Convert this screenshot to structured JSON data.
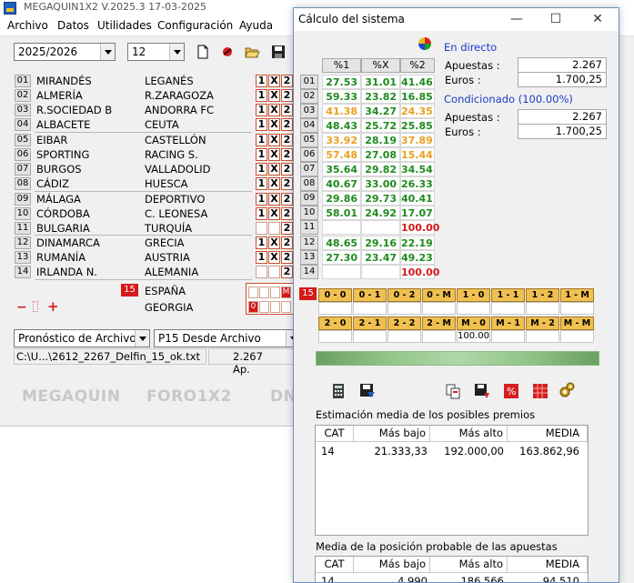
{
  "main": {
    "title": "MEGAQUIN1X2  V.2025.3 17-03-2025",
    "menu": [
      "Archivo",
      "Datos",
      "Utilidades",
      "Configuración",
      "Ayuda"
    ],
    "season": "2025/2026",
    "jornada": "12",
    "matches": [
      {
        "num": "01",
        "home": "MIRANDÉS",
        "away": "LEGANÉS",
        "picks": [
          true,
          true,
          true
        ]
      },
      {
        "num": "02",
        "home": "ALMERÍA",
        "away": "R.ZARAGOZA",
        "picks": [
          true,
          true,
          true
        ]
      },
      {
        "num": "03",
        "home": "R.SOCIEDAD B",
        "away": "ANDORRA FC",
        "picks": [
          true,
          true,
          true
        ]
      },
      {
        "num": "04",
        "home": "ALBACETE",
        "away": "CEUTA",
        "picks": [
          true,
          true,
          true
        ]
      },
      {
        "num": "05",
        "home": "EIBAR",
        "away": "CASTELLÓN",
        "picks": [
          true,
          true,
          true
        ]
      },
      {
        "num": "06",
        "home": "SPORTING",
        "away": "RACING S.",
        "picks": [
          true,
          true,
          true
        ]
      },
      {
        "num": "07",
        "home": "BURGOS",
        "away": "VALLADOLID",
        "picks": [
          true,
          true,
          true
        ]
      },
      {
        "num": "08",
        "home": "CÁDIZ",
        "away": "HUESCA",
        "picks": [
          true,
          true,
          true
        ]
      },
      {
        "num": "09",
        "home": "MÁLAGA",
        "away": "DEPORTIVO",
        "picks": [
          true,
          true,
          true
        ]
      },
      {
        "num": "10",
        "home": "CÓRDOBA",
        "away": "C. LEONESA",
        "picks": [
          true,
          true,
          true
        ]
      },
      {
        "num": "11",
        "home": "BULGARIA",
        "away": "TURQUÍA",
        "picks": [
          false,
          false,
          true
        ]
      },
      {
        "num": "12",
        "home": "DINAMARCA",
        "away": "GRECIA",
        "picks": [
          true,
          true,
          true
        ]
      },
      {
        "num": "13",
        "home": "RUMANÍA",
        "away": "AUSTRIA",
        "picks": [
          true,
          true,
          true
        ]
      },
      {
        "num": "14",
        "home": "IRLANDA N.",
        "away": "ALEMANIA",
        "picks": [
          false,
          false,
          true
        ]
      }
    ],
    "p15": {
      "num": "15",
      "home": "ESPAÑA",
      "away": "GEORGIA",
      "row1": [
        "0",
        "1",
        "2",
        "M"
      ],
      "row2": [
        "0",
        "1",
        "2",
        "M"
      ]
    },
    "pick_labels": [
      "1",
      "X",
      "2"
    ],
    "source_combo": "Pronóstico de Archivo",
    "p15_combo": "P15 Desde Archivo",
    "file_path": "C:\\U...\\2612_2267_Delfin_15_ok.txt",
    "file_bets": "2.267 Ap.",
    "bottom_labels": [
      "MEGAQUIN",
      "FORO1X2",
      "DN"
    ]
  },
  "dialog": {
    "title": "Cálculo del sistema",
    "grid_headers": [
      "%1",
      "%X",
      "%2"
    ],
    "grid": [
      {
        "num": "01",
        "v1": "27.53",
        "vx": "31.01",
        "v2": "41.46",
        "c1": "#1e8a1e",
        "cx": "#1e8a1e",
        "c2": "#1e8a1e"
      },
      {
        "num": "02",
        "v1": "59.33",
        "vx": "23.82",
        "v2": "16.85",
        "c1": "#1e8a1e",
        "cx": "#1e8a1e",
        "c2": "#1e8a1e"
      },
      {
        "num": "03",
        "v1": "41.38",
        "vx": "34.27",
        "v2": "24.35",
        "c1": "#e8a020",
        "cx": "#1e8a1e",
        "c2": "#e8a020"
      },
      {
        "num": "04",
        "v1": "48.43",
        "vx": "25.72",
        "v2": "25.85",
        "c1": "#1e8a1e",
        "cx": "#1e8a1e",
        "c2": "#1e8a1e"
      },
      {
        "num": "05",
        "v1": "33.92",
        "vx": "28.19",
        "v2": "37.89",
        "c1": "#e8a020",
        "cx": "#1e8a1e",
        "c2": "#e8a020"
      },
      {
        "num": "06",
        "v1": "57.48",
        "vx": "27.08",
        "v2": "15.44",
        "c1": "#e8a020",
        "cx": "#1e8a1e",
        "c2": "#e8a020"
      },
      {
        "num": "07",
        "v1": "35.64",
        "vx": "29.82",
        "v2": "34.54",
        "c1": "#1e8a1e",
        "cx": "#1e8a1e",
        "c2": "#1e8a1e"
      },
      {
        "num": "08",
        "v1": "40.67",
        "vx": "33.00",
        "v2": "26.33",
        "c1": "#1e8a1e",
        "cx": "#1e8a1e",
        "c2": "#1e8a1e"
      },
      {
        "num": "09",
        "v1": "29.86",
        "vx": "29.73",
        "v2": "40.41",
        "c1": "#1e8a1e",
        "cx": "#1e8a1e",
        "c2": "#1e8a1e"
      },
      {
        "num": "10",
        "v1": "58.01",
        "vx": "24.92",
        "v2": "17.07",
        "c1": "#1e8a1e",
        "cx": "#1e8a1e",
        "c2": "#1e8a1e"
      },
      {
        "num": "11",
        "v1": "",
        "vx": "",
        "v2": "100.00",
        "c1": "#1e8a1e",
        "cx": "#1e8a1e",
        "c2": "#d41a1a"
      },
      {
        "num": "12",
        "v1": "48.65",
        "vx": "29.16",
        "v2": "22.19",
        "c1": "#1e8a1e",
        "cx": "#1e8a1e",
        "c2": "#1e8a1e"
      },
      {
        "num": "13",
        "v1": "27.30",
        "vx": "23.47",
        "v2": "49.23",
        "c1": "#1e8a1e",
        "cx": "#1e8a1e",
        "c2": "#1e8a1e"
      },
      {
        "num": "14",
        "v1": "",
        "vx": "",
        "v2": "100.00",
        "c1": "#1e8a1e",
        "cx": "#1e8a1e",
        "c2": "#d41a1a"
      }
    ],
    "live": {
      "heading": "En directo",
      "bets_label": "Apuestas :",
      "bets": "2.267",
      "euros_label": "Euros :",
      "euros": "1.700,25"
    },
    "cond": {
      "heading": "Condicionado (100.00%)",
      "bets_label": "Apuestas :",
      "bets": "2.267",
      "euros_label": "Euros :",
      "euros": "1.700,25"
    },
    "p15_num": "15",
    "combo_row1": [
      "0 - 0",
      "0 - 1",
      "0 - 2",
      "0 - M",
      "1 - 0",
      "1 - 1",
      "1 - 2",
      "1 - M"
    ],
    "combo_row2": [
      "2 - 0",
      "2 - 1",
      "2 - 2",
      "2 - M",
      "M - 0",
      "M - 1",
      "M - 2",
      "M - M"
    ],
    "combo_values_row1": [
      "",
      "",
      "",
      "",
      "",
      "",
      "",
      ""
    ],
    "combo_values_row2": [
      "",
      "",
      "",
      "",
      "100.00",
      "",
      "",
      ""
    ],
    "prizes_title": "Estimación media de los posibles premios",
    "prizes_headers": [
      "CAT",
      "Más bajo",
      "Más alto",
      "MEDIA"
    ],
    "prizes_rows": [
      {
        "cat": "14",
        "low": "21.333,33",
        "high": "192.000,00",
        "avg": "163.862,96"
      }
    ],
    "position_title": "Media de la posición probable de las apuestas",
    "position_headers": [
      "CAT",
      "Más bajo",
      "Más alto",
      "MEDIA"
    ],
    "position_rows": [
      {
        "cat": "14",
        "low": "4.990",
        "high": "186.566",
        "avg": "94.510"
      }
    ]
  }
}
